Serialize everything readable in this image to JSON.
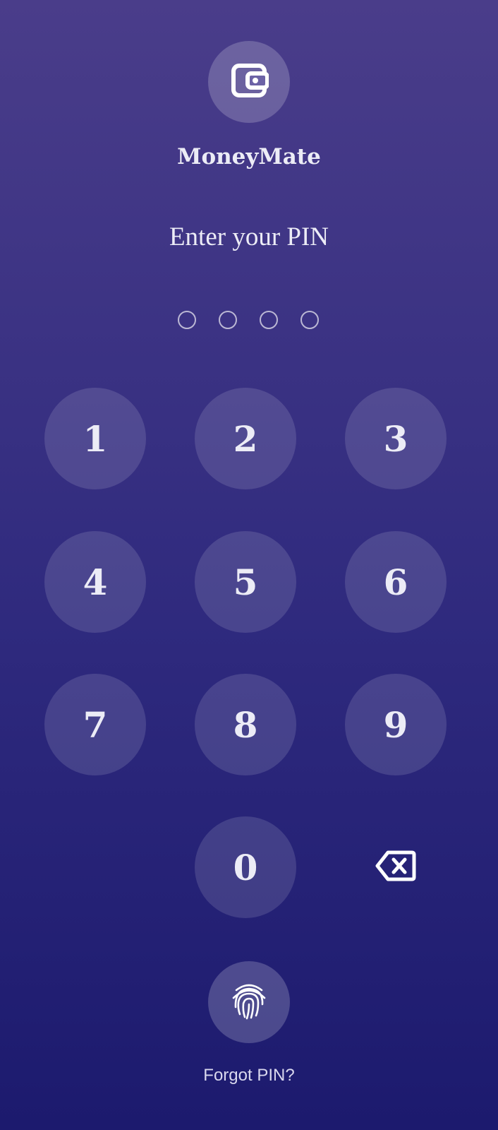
{
  "app": {
    "name": "MoneyMate",
    "logo_icon": "wallet-icon"
  },
  "pin": {
    "prompt": "Enter your PIN",
    "length": 4,
    "entered": 0
  },
  "keypad": {
    "keys": [
      "1",
      "2",
      "3",
      "4",
      "5",
      "6",
      "7",
      "8",
      "9",
      "0"
    ],
    "backspace_icon": "backspace-icon"
  },
  "biometric": {
    "icon": "fingerprint-icon"
  },
  "forgot_label": "Forgot PIN?",
  "colors": {
    "background_top": "#4a3d8a",
    "background_bottom": "#1c1a6e",
    "text": "#ececf6"
  }
}
